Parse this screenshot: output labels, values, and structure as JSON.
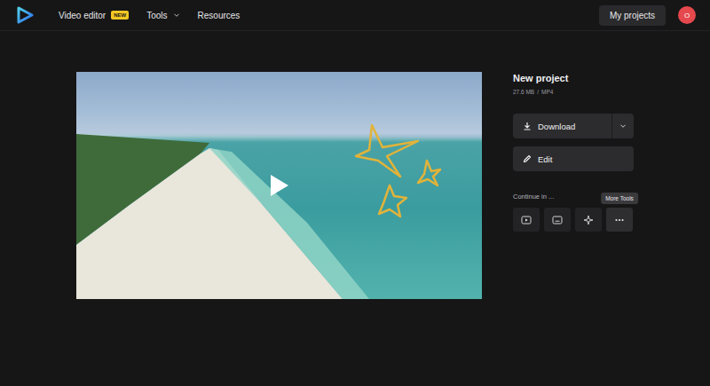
{
  "nav": {
    "items": [
      {
        "label": "Video editor",
        "badge": "NEW",
        "dropdown": false
      },
      {
        "label": "Tools",
        "badge": "",
        "dropdown": true
      },
      {
        "label": "Resources",
        "badge": "",
        "dropdown": false
      }
    ],
    "my_projects": "My projects",
    "avatar": "O"
  },
  "project": {
    "title": "New project",
    "size": "27.6 MB",
    "separator": "/",
    "format": "MP4"
  },
  "actions": {
    "download": "Download",
    "edit": "Edit"
  },
  "continue": {
    "label": "Continue in ...",
    "tools": [
      {
        "kind": "player",
        "hovered": false
      },
      {
        "kind": "subtitles",
        "hovered": false
      },
      {
        "kind": "sparkle",
        "hovered": false
      },
      {
        "kind": "more",
        "hovered": true
      }
    ],
    "tooltip": "More Tools"
  }
}
